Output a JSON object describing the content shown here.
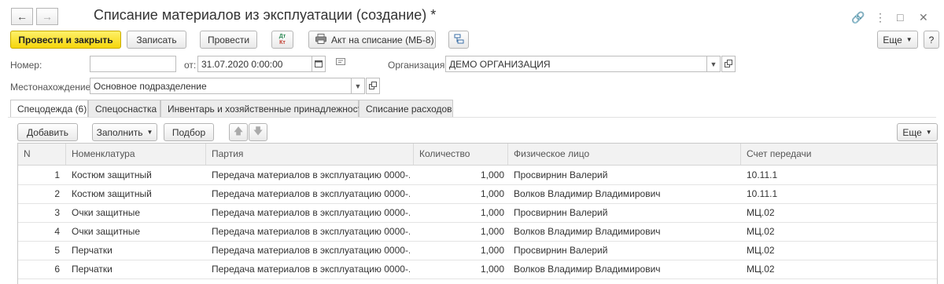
{
  "header": {
    "title": "Списание материалов из эксплуатации (создание) *",
    "back_icon": "←",
    "forward_icon": "→"
  },
  "toolbar": {
    "post_and_close": "Провести и закрыть",
    "save": "Записать",
    "post": "Провести",
    "dt_kt_top": "Дт",
    "dt_kt_bottom": "Кт",
    "print_act": "Акт на списание (МБ-8)",
    "more": "Еще"
  },
  "form": {
    "number_label": "Номер:",
    "number_value": "",
    "date_label": "от:",
    "date_value": "31.07.2020  0:00:00",
    "org_label": "Организация:",
    "org_value": "ДЕМО ОРГАНИЗАЦИЯ",
    "location_label": "Местонахождение:",
    "location_value": "Основное подразделение"
  },
  "tabs": [
    {
      "label": "Спецодежда (6)"
    },
    {
      "label": "Спецоснастка"
    },
    {
      "label": "Инвентарь и хозяйственные принадлежности"
    },
    {
      "label": "Списание расходов"
    }
  ],
  "table_toolbar": {
    "add": "Добавить",
    "fill": "Заполнить",
    "select": "Подбор",
    "more": "Еще"
  },
  "table": {
    "columns": [
      "N",
      "Номенклатура",
      "Партия",
      "Количество",
      "Физическое лицо",
      "Счет передачи"
    ],
    "rows": [
      {
        "n": "1",
        "item": "Костюм защитный",
        "batch": "Передача материалов в эксплуатацию 0000-...",
        "qty": "1,000",
        "person": "Просвирнин Валерий",
        "account": "10.11.1"
      },
      {
        "n": "2",
        "item": "Костюм защитный",
        "batch": "Передача материалов в эксплуатацию 0000-...",
        "qty": "1,000",
        "person": "Волков Владимир Владимирович",
        "account": "10.11.1"
      },
      {
        "n": "3",
        "item": "Очки защитные",
        "batch": "Передача материалов в эксплуатацию 0000-...",
        "qty": "1,000",
        "person": "Просвирнин Валерий",
        "account": "МЦ.02"
      },
      {
        "n": "4",
        "item": "Очки защитные",
        "batch": "Передача материалов в эксплуатацию 0000-...",
        "qty": "1,000",
        "person": "Волков Владимир Владимирович",
        "account": "МЦ.02"
      },
      {
        "n": "5",
        "item": "Перчатки",
        "batch": "Передача материалов в эксплуатацию 0000-...",
        "qty": "1,000",
        "person": "Просвирнин Валерий",
        "account": "МЦ.02"
      },
      {
        "n": "6",
        "item": "Перчатки",
        "batch": "Передача материалов в эксплуатацию 0000-...",
        "qty": "1,000",
        "person": "Волков Владимир Владимирович",
        "account": "МЦ.02"
      }
    ]
  },
  "colors": {
    "primary_button": "#f5d60b",
    "accent_arrow": "#c0392b"
  }
}
